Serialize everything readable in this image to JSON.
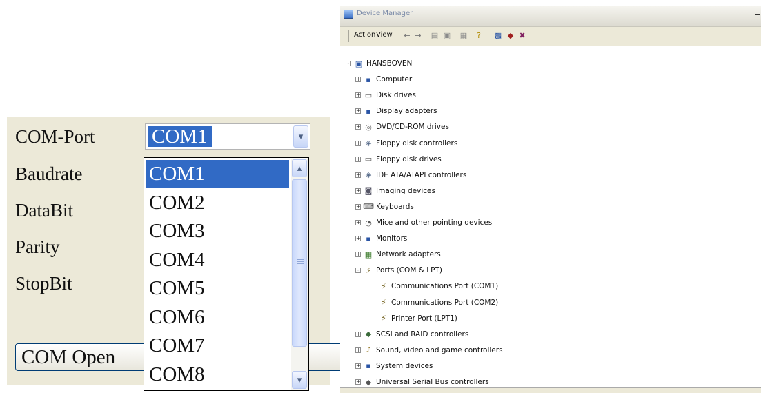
{
  "form": {
    "labels": [
      "COM-Port",
      "Baudrate",
      "DataBit",
      "Parity",
      "StopBit"
    ],
    "com_port_value": "COM1",
    "open_button_label": "COM Open",
    "dropdown_options": [
      "COM1",
      "COM2",
      "COM3",
      "COM4",
      "COM5",
      "COM6",
      "COM7",
      "COM8"
    ],
    "dropdown_selected": "COM1",
    "dropdown_arrow": "▾",
    "scroll_up_arrow": "▴",
    "scroll_down_arrow": "▾"
  },
  "device_manager": {
    "title": "Device Manager",
    "menu": [
      "Action",
      "View"
    ],
    "toolbar_icons": [
      "back-arrow-icon",
      "forward-arrow-icon",
      "up-folder-icon",
      "show-hide-tree-icon",
      "properties-icon",
      "help-icon",
      "scan-hardware-icon",
      "update-driver-icon",
      "uninstall-icon"
    ],
    "tree": {
      "root": "HANSBOVEN",
      "items": [
        {
          "label": "Computer",
          "icon": "computer-icon",
          "children": []
        },
        {
          "label": "Disk drives",
          "icon": "disk-drive-icon",
          "children": []
        },
        {
          "label": "Display adapters",
          "icon": "display-adapter-icon",
          "children": []
        },
        {
          "label": "DVD/CD-ROM drives",
          "icon": "dvd-icon",
          "children": []
        },
        {
          "label": "Floppy disk controllers",
          "icon": "controller-icon",
          "children": []
        },
        {
          "label": "Floppy disk drives",
          "icon": "floppy-drive-icon",
          "children": []
        },
        {
          "label": "IDE ATA/ATAPI controllers",
          "icon": "controller-icon",
          "children": []
        },
        {
          "label": "Imaging devices",
          "icon": "camera-icon",
          "children": []
        },
        {
          "label": "Keyboards",
          "icon": "keyboard-icon",
          "children": []
        },
        {
          "label": "Mice and other pointing devices",
          "icon": "mouse-icon",
          "children": []
        },
        {
          "label": "Monitors",
          "icon": "monitor-icon",
          "children": []
        },
        {
          "label": "Network adapters",
          "icon": "network-adapter-icon",
          "children": []
        },
        {
          "label": "Ports (COM & LPT)",
          "icon": "port-icon",
          "expanded": true,
          "children": [
            "Communications Port (COM1)",
            "Communications Port (COM2)",
            "Printer Port (LPT1)"
          ]
        },
        {
          "label": "SCSI and RAID controllers",
          "icon": "scsi-icon",
          "children": []
        },
        {
          "label": "Sound, video and game controllers",
          "icon": "sound-icon",
          "children": []
        },
        {
          "label": "System devices",
          "icon": "system-device-icon",
          "children": []
        },
        {
          "label": "Universal Serial Bus controllers",
          "icon": "usb-icon",
          "children": []
        }
      ]
    }
  }
}
